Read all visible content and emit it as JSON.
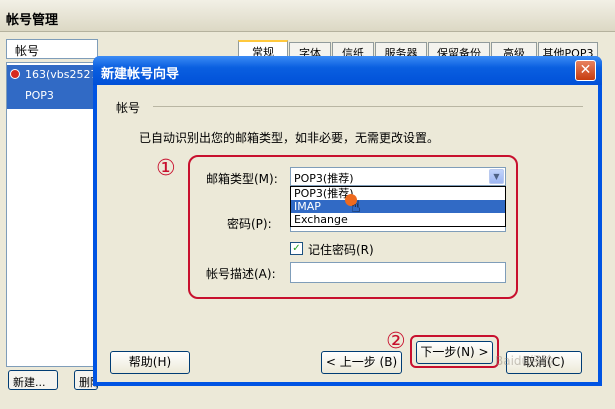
{
  "background_window": {
    "title": "帐号管理",
    "list_header": "帐号",
    "account": {
      "name": "163(vbs2527",
      "type": "POP3"
    },
    "tabs": [
      "常规",
      "字体",
      "信纸",
      "服务器",
      "保留备份",
      "高级",
      "其他POP3"
    ],
    "buttons": {
      "new": "新建...",
      "delete": "删除"
    }
  },
  "dialog": {
    "title": "新建帐号向导",
    "close_glyph": "✕",
    "section_label": "帐号",
    "info_text": "已自动识别出您的邮箱类型，如非必要，无需更改设置。",
    "fields": {
      "mailbox_type_label": "邮箱类型(M):",
      "mailbox_type_value": "POP3(推荐)",
      "password_label": "密码(P):",
      "remember_password_label": "记住密码(R)",
      "remember_password_checked": true,
      "description_label": "帐号描述(A):",
      "description_value": ""
    },
    "dropdown_options": [
      {
        "label": "POP3(推荐)",
        "selected": false
      },
      {
        "label": "IMAP",
        "selected": true
      },
      {
        "label": "Exchange",
        "selected": false
      }
    ],
    "buttons": {
      "help": "帮助(H)",
      "prev": "< 上一步 (B)",
      "next": "下一步(N) >",
      "cancel": "取消(C)"
    },
    "annotations": {
      "marker_1": "①",
      "marker_2": "②"
    }
  },
  "watermark": "Baidu经验",
  "colors": {
    "title_blue": "#0054e3",
    "highlight_red": "#c8102e",
    "selection_blue": "#316ac5"
  },
  "icons": {
    "close": "close-icon",
    "dropdown": "chevron-down-icon",
    "cursor": "hand-pointer-icon",
    "account": "account-icon",
    "check": "check-icon"
  }
}
